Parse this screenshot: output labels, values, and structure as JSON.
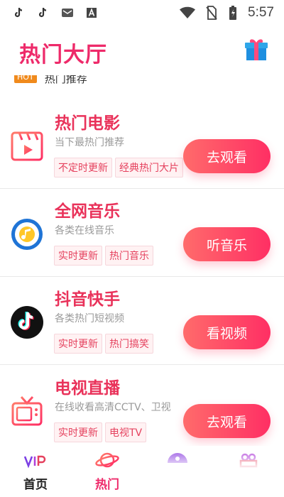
{
  "statusbar": {
    "time": "5:57",
    "left_icons": [
      "tiktok-icon",
      "tiktok-icon",
      "mail-app-icon",
      "a-app-icon"
    ],
    "right_icons": [
      "wifi-icon",
      "no-sim-icon",
      "battery-icon"
    ]
  },
  "header": {
    "title": "热门大厅",
    "gift_icon": "gift-icon"
  },
  "hot_recommend": {
    "badge": "HOT",
    "text": "热门推荐"
  },
  "cards": [
    {
      "title": "热门电影",
      "subtitle": "当下最热门推荐",
      "tags": [
        "不定时更新",
        "经典热门大片"
      ],
      "action": "去观看",
      "icon": "movie-icon"
    },
    {
      "title": "全网音乐",
      "subtitle": "各类在线音乐",
      "tags": [
        "实时更新",
        "热门音乐"
      ],
      "action": "听音乐",
      "icon": "music-disc-icon"
    },
    {
      "title": "抖音快手",
      "subtitle": "各类热门短视频",
      "tags": [
        "实时更新",
        "热门搞笑"
      ],
      "action": "看视频",
      "icon": "tiktok-logo-icon"
    },
    {
      "title": "电视直播",
      "subtitle": "在线收看高清CCTV、卫视",
      "tags": [
        "实时更新",
        "电视TV"
      ],
      "action": "去观看",
      "icon": "tv-icon"
    }
  ],
  "bottom_nav": [
    {
      "label": "首页",
      "icon": "vip-icon",
      "active": false
    },
    {
      "label": "热门",
      "icon": "planet-icon",
      "active": true
    },
    {
      "label": "",
      "icon": "purple-half-circle-icon",
      "active": false
    },
    {
      "label": "",
      "icon": "film-camera-icon",
      "active": false
    }
  ],
  "colors": {
    "accent": "#ee2a6a",
    "button_start": "#ff6b6b",
    "button_end": "#ff2f64",
    "tag_text": "#e5415e"
  }
}
